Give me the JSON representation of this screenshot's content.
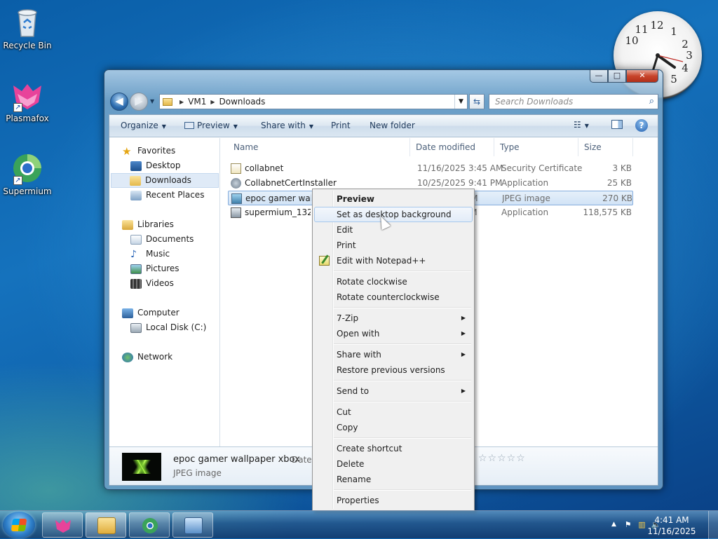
{
  "desktop": {
    "icons": [
      {
        "label": "Recycle Bin",
        "icon": "recycle-bin-icon"
      },
      {
        "label": "Plasmafox",
        "icon": "plasmafox-icon"
      },
      {
        "label": "Supermium",
        "icon": "supermium-icon"
      }
    ],
    "clock_numbers": [
      "12",
      "1",
      "2",
      "3",
      "4",
      "5",
      "10",
      "11"
    ]
  },
  "window": {
    "caption": {
      "minimize": "—",
      "maximize": "□",
      "close": "✕"
    },
    "address": {
      "segments": [
        "VM1",
        "Downloads"
      ],
      "separator": "▶"
    },
    "search_placeholder": "Search Downloads",
    "toolbar": {
      "organize": "Organize",
      "preview": "Preview",
      "share_with": "Share with",
      "print": "Print",
      "new_folder": "New folder"
    },
    "nav": {
      "favorites": "Favorites",
      "desktop": "Desktop",
      "downloads": "Downloads",
      "recent_places": "Recent Places",
      "libraries": "Libraries",
      "documents": "Documents",
      "music": "Music",
      "pictures": "Pictures",
      "videos": "Videos",
      "computer": "Computer",
      "local_disk": "Local Disk (C:)",
      "network": "Network"
    },
    "columns": {
      "name": "Name",
      "date": "Date modified",
      "type": "Type",
      "size": "Size"
    },
    "files": [
      {
        "name": "collabnet",
        "date": "11/16/2025 3:45 AM",
        "type": "Security Certificate",
        "size": "3 KB"
      },
      {
        "name": "CollabnetCertInstaller",
        "date": "10/25/2025 9:41 PM",
        "type": "Application",
        "size": "25 KB"
      },
      {
        "name": "epoc gamer wallp",
        "date": "AM",
        "type": "JPEG image",
        "size": "270 KB"
      },
      {
        "name": "supermium_132_6",
        "date": "AM",
        "type": "Application",
        "size": "118,575 KB"
      }
    ],
    "details": {
      "name": "epoc gamer wallpaper xbox",
      "type": "JPEG image",
      "date_label": "Date",
      "rating": "☆☆☆☆☆"
    }
  },
  "context_menu": {
    "preview": "Preview",
    "set_background": "Set as desktop background",
    "edit": "Edit",
    "print": "Print",
    "edit_notepad": "Edit with Notepad++",
    "rotate_cw": "Rotate clockwise",
    "rotate_ccw": "Rotate counterclockwise",
    "seven_zip": "7-Zip",
    "open_with": "Open with",
    "share_with": "Share with",
    "restore": "Restore previous versions",
    "send_to": "Send to",
    "cut": "Cut",
    "copy": "Copy",
    "create_shortcut": "Create shortcut",
    "delete": "Delete",
    "rename": "Rename",
    "properties": "Properties"
  },
  "taskbar": {
    "time": "4:41 AM",
    "date": "11/16/2025"
  },
  "colors": {
    "accent": "#2d6db0",
    "selection": "#d1e3f6",
    "menu_bg": "#f0f0f0"
  }
}
